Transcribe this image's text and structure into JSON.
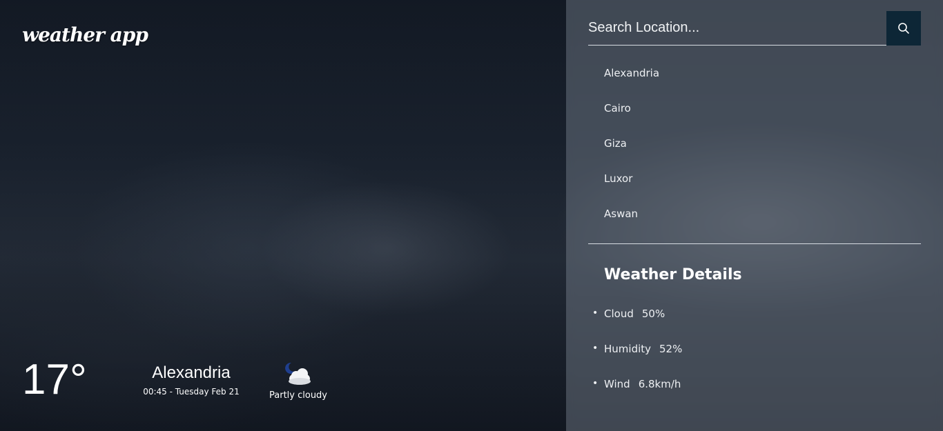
{
  "app": {
    "logo": "weather app"
  },
  "current": {
    "temperature": "17°",
    "city": "Alexandria",
    "datetime": "00:45 - Tuesday Feb 21",
    "condition": "Partly cloudy",
    "condition_icon": "partly-cloudy-night-icon"
  },
  "search": {
    "placeholder": "Search Location...",
    "value": "",
    "button_icon": "search-icon"
  },
  "cities": [
    {
      "label": "Alexandria"
    },
    {
      "label": "Cairo"
    },
    {
      "label": "Giza"
    },
    {
      "label": "Luxor"
    },
    {
      "label": "Aswan"
    }
  ],
  "details": {
    "title": "Weather Details",
    "items": [
      {
        "label": "Cloud",
        "value": "50%"
      },
      {
        "label": "Humidity",
        "value": "52%"
      },
      {
        "label": "Wind",
        "value": "6.8km/h"
      }
    ]
  },
  "colors": {
    "search_button": "#0d2636",
    "panel_overlay": "rgba(140,150,162,0.38)",
    "text": "#ffffff"
  }
}
